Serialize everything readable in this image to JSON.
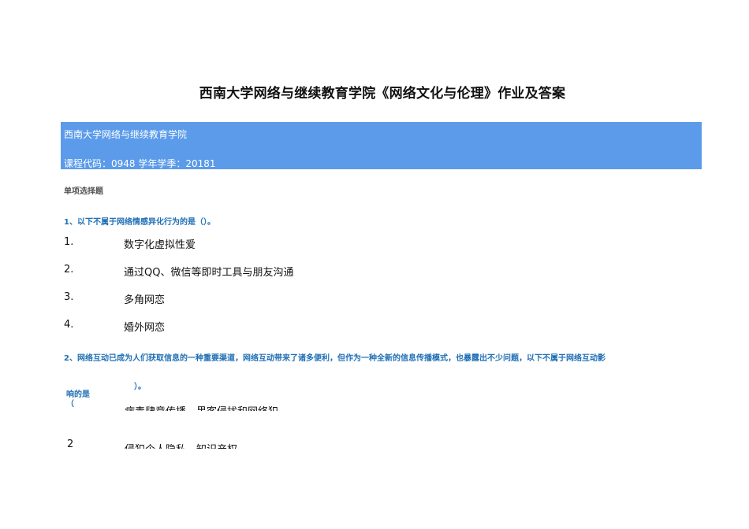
{
  "document": {
    "title": "西南大学网络与继续教育学院《网络文化与伦理》作业及答案"
  },
  "header_band": {
    "institution": "西南大学网络与继续教育学院",
    "course_info": "课程代码：0948 学年学季：20181"
  },
  "section": {
    "label": "单项选择题"
  },
  "questions": [
    {
      "text": "1、以下不属于网络情感异化行为的是（）。",
      "options": [
        {
          "num": "1.",
          "text": "数字化虚拟性爱"
        },
        {
          "num": "2.",
          "text": "通过QQ、微信等即时工具与朋友沟通"
        },
        {
          "num": "3.",
          "text": "多角网恋"
        },
        {
          "num": "4.",
          "text": "婚外网恋"
        }
      ]
    },
    {
      "text": "2、网络互动已成为人们获取信息的一种重要渠道，网络互动带来了诸多便利，但作为一种全新的信息传播模式，也暴露出不少问题，以下不属于网络互动影",
      "continuation": "）。",
      "tail_line1": "响的是",
      "tail_line2": "（",
      "options": [
        {
          "num": "",
          "text": "病毒肆意传播、黑客侵扰和网络犯"
        },
        {
          "num": "2",
          "text": "侵犯个人隐私、知识产权"
        }
      ]
    }
  ]
}
